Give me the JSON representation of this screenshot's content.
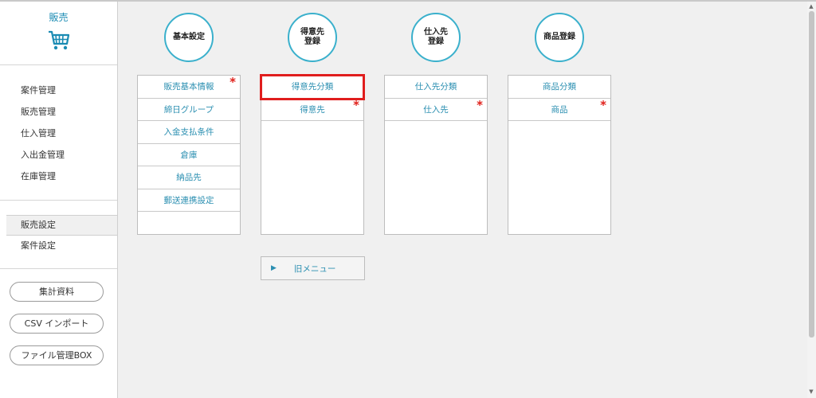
{
  "sidebar": {
    "title": "販売",
    "icon": "shopping-cart-icon",
    "menu1": [
      "案件管理",
      "販売管理",
      "仕入管理",
      "入出金管理",
      "在庫管理"
    ],
    "menu2": [
      "販売設定",
      "案件設定"
    ],
    "active_item": "販売設定",
    "buttons": [
      "集計資料",
      "CSV インポート",
      "ファイル管理BOX"
    ]
  },
  "columns": [
    {
      "title": "基本設定",
      "items": [
        {
          "label": "販売基本情報",
          "required": true
        },
        {
          "label": "締日グループ",
          "required": false
        },
        {
          "label": "入金支払条件",
          "required": false
        },
        {
          "label": "倉庫",
          "required": false
        },
        {
          "label": "納品先",
          "required": false
        },
        {
          "label": "郵送連携設定",
          "required": false
        }
      ]
    },
    {
      "title": "得意先\n登録",
      "items": [
        {
          "label": "得意先分類",
          "required": false,
          "highlighted": true
        },
        {
          "label": "得意先",
          "required": true
        }
      ]
    },
    {
      "title": "仕入先\n登録",
      "items": [
        {
          "label": "仕入先分類",
          "required": false
        },
        {
          "label": "仕入先",
          "required": true
        }
      ]
    },
    {
      "title": "商品登録",
      "items": [
        {
          "label": "商品分類",
          "required": false
        },
        {
          "label": "商品",
          "required": true
        }
      ]
    }
  ],
  "old_menu": {
    "label": "旧メニュー",
    "icon": "play-triangle-icon"
  },
  "required_mark": "*",
  "colors": {
    "accent": "#3ab0cc",
    "link": "#2b8fb1",
    "required": "#e0201a",
    "highlight": "#e01d1d"
  }
}
